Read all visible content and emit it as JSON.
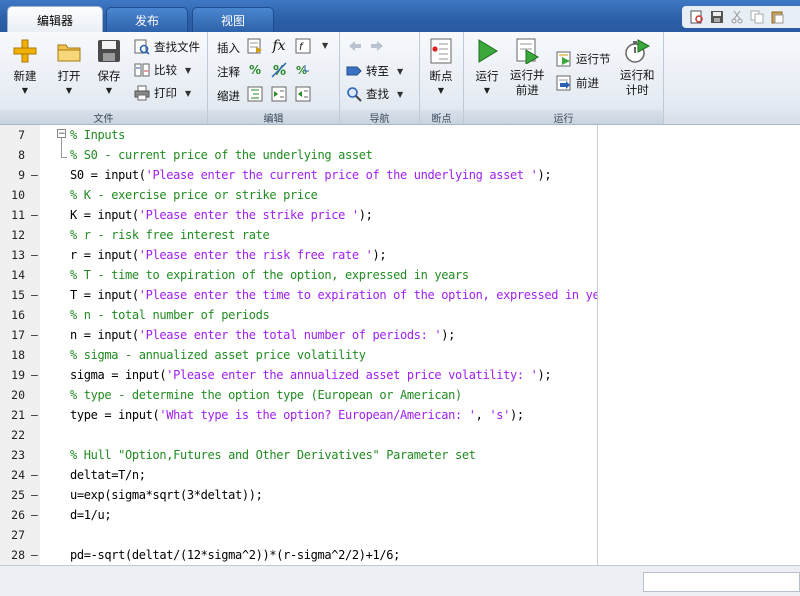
{
  "tabs": [
    {
      "label": "编辑器",
      "active": true
    },
    {
      "label": "发布",
      "active": false
    },
    {
      "label": "视图",
      "active": false
    }
  ],
  "ribbon": {
    "file": {
      "label": "文件",
      "new_label": "新建",
      "open_label": "打开",
      "save_label": "保存",
      "find_files_label": "查找文件",
      "compare_label": "比较",
      "print_label": "打印"
    },
    "edit": {
      "label": "编辑",
      "insert_label": "插入",
      "comment_label": "注释",
      "indent_label": "缩进"
    },
    "navigate": {
      "label": "导航",
      "goto_label": "转至",
      "find_label": "查找"
    },
    "breakpoints": {
      "label": "断点",
      "breakpoints_label": "断点"
    },
    "run": {
      "label": "运行",
      "run_label": "运行",
      "run_advance_label": "运行并\n前进",
      "run_section_label": "运行节",
      "advance_label": "前进",
      "run_time_label": "运行和\n计时"
    }
  },
  "colors": {
    "comment": "#228b22",
    "string": "#a020f0",
    "tabbar": "#2c5fa8"
  },
  "editor": {
    "lines": [
      {
        "num": "7",
        "dash": false,
        "segments": [
          {
            "t": "% Inputs",
            "c": "cmt"
          }
        ]
      },
      {
        "num": "8",
        "dash": false,
        "segments": [
          {
            "t": "% S0 - current price of the underlying asset",
            "c": "cmt"
          }
        ]
      },
      {
        "num": "9",
        "dash": true,
        "segments": [
          {
            "t": "S0 = input(",
            "c": "plain"
          },
          {
            "t": "'Please enter the current price of the underlying asset '",
            "c": "str"
          },
          {
            "t": ");",
            "c": "plain"
          }
        ]
      },
      {
        "num": "10",
        "dash": false,
        "segments": [
          {
            "t": "% K - exercise price or strike price",
            "c": "cmt"
          }
        ]
      },
      {
        "num": "11",
        "dash": true,
        "segments": [
          {
            "t": "K = input(",
            "c": "plain"
          },
          {
            "t": "'Please enter the strike price '",
            "c": "str"
          },
          {
            "t": ");",
            "c": "plain"
          }
        ]
      },
      {
        "num": "12",
        "dash": false,
        "segments": [
          {
            "t": "% r - risk free interest rate",
            "c": "cmt"
          }
        ]
      },
      {
        "num": "13",
        "dash": true,
        "segments": [
          {
            "t": "r = input(",
            "c": "plain"
          },
          {
            "t": "'Please enter the risk free rate '",
            "c": "str"
          },
          {
            "t": ");",
            "c": "plain"
          }
        ]
      },
      {
        "num": "14",
        "dash": false,
        "segments": [
          {
            "t": "% T - time to expiration of the option, expressed in years",
            "c": "cmt"
          }
        ]
      },
      {
        "num": "15",
        "dash": true,
        "segments": [
          {
            "t": "T = input(",
            "c": "plain"
          },
          {
            "t": "'Please enter the time to expiration of the option, expressed in years '",
            "c": "str"
          },
          {
            "t": ");",
            "c": "plain"
          }
        ]
      },
      {
        "num": "16",
        "dash": false,
        "segments": [
          {
            "t": "% n - total number of periods",
            "c": "cmt"
          }
        ]
      },
      {
        "num": "17",
        "dash": true,
        "segments": [
          {
            "t": "n = input(",
            "c": "plain"
          },
          {
            "t": "'Please enter the total number of periods: '",
            "c": "str"
          },
          {
            "t": ");",
            "c": "plain"
          }
        ]
      },
      {
        "num": "18",
        "dash": false,
        "segments": [
          {
            "t": "% sigma - annualized asset price volatility",
            "c": "cmt"
          }
        ]
      },
      {
        "num": "19",
        "dash": true,
        "segments": [
          {
            "t": "sigma = input(",
            "c": "plain"
          },
          {
            "t": "'Please enter the annualized asset price volatility: '",
            "c": "str"
          },
          {
            "t": ");",
            "c": "plain"
          }
        ]
      },
      {
        "num": "20",
        "dash": false,
        "segments": [
          {
            "t": "% type - determine the option type (European or American)",
            "c": "cmt"
          }
        ]
      },
      {
        "num": "21",
        "dash": true,
        "segments": [
          {
            "t": "type = input(",
            "c": "plain"
          },
          {
            "t": "'What type is the option? European/American: '",
            "c": "str"
          },
          {
            "t": ", ",
            "c": "plain"
          },
          {
            "t": "'s'",
            "c": "str"
          },
          {
            "t": ");",
            "c": "plain"
          }
        ]
      },
      {
        "num": "22",
        "dash": false,
        "segments": []
      },
      {
        "num": "23",
        "dash": false,
        "segments": [
          {
            "t": "% Hull \"Option,Futures and Other Derivatives\" Parameter set",
            "c": "cmt"
          }
        ]
      },
      {
        "num": "24",
        "dash": true,
        "segments": [
          {
            "t": "deltat=T/n;",
            "c": "plain"
          }
        ]
      },
      {
        "num": "25",
        "dash": true,
        "segments": [
          {
            "t": "u=exp(sigma*sqrt(3*deltat));",
            "c": "plain"
          }
        ]
      },
      {
        "num": "26",
        "dash": true,
        "segments": [
          {
            "t": "d=1/u;",
            "c": "plain"
          }
        ]
      },
      {
        "num": "27",
        "dash": false,
        "segments": []
      },
      {
        "num": "28",
        "dash": true,
        "segments": [
          {
            "t": "pd=-sqrt(deltat/(12*sigma^2))*(r-sigma^2/2)+1/6;",
            "c": "plain"
          }
        ]
      }
    ]
  },
  "status": {
    "text": ""
  }
}
